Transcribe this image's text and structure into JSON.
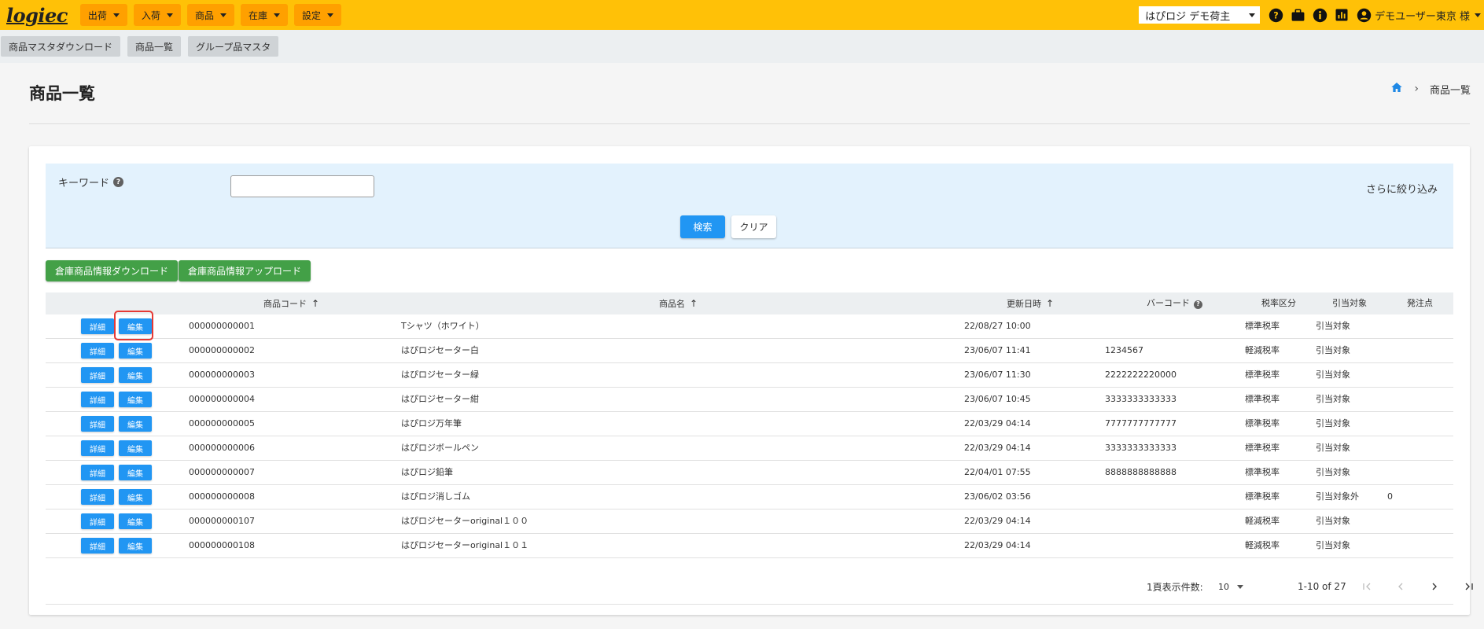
{
  "header": {
    "logo": "logiec",
    "menus": [
      {
        "label": "出荷"
      },
      {
        "label": "入荷"
      },
      {
        "label": "商品"
      },
      {
        "label": "在庫"
      },
      {
        "label": "設定"
      }
    ],
    "shipper_select": "はぴロジ デモ荷主",
    "user_name": "デモユーザー東京 様",
    "icons": [
      "help-circle-icon",
      "briefcase-icon",
      "info-icon",
      "bar-chart-icon",
      "account-circle-icon",
      "chevron-down-icon"
    ]
  },
  "subnav": {
    "items": [
      {
        "label": "商品マスタダウンロード"
      },
      {
        "label": "商品一覧"
      },
      {
        "label": "グループ品マスタ"
      }
    ]
  },
  "page": {
    "title": "商品一覧",
    "breadcrumb_current": "商品一覧"
  },
  "search": {
    "keyword_label": "キーワード",
    "help_mark": "?",
    "keyword_value": "",
    "narrow_link": "さらに絞り込み",
    "search_button": "検索",
    "clear_button": "クリア"
  },
  "actions": {
    "download_button": "倉庫商品情報ダウンロード",
    "upload_button": "倉庫商品情報アップロード"
  },
  "table": {
    "headers": {
      "code": "商品コード",
      "name": "商品名",
      "updated": "更新日時",
      "barcode": "バーコード",
      "tax": "税率区分",
      "allocation": "引当対象",
      "reorder": "発注点"
    },
    "sort_arrow": "↑",
    "detail_label": "詳細",
    "edit_label": "編集",
    "rows": [
      {
        "code": "000000000001",
        "name": "Tシャツ（ホワイト）",
        "updated": "22/08/27 10:00",
        "barcode": "",
        "tax": "標準税率",
        "allocation": "引当対象",
        "reorder": ""
      },
      {
        "code": "000000000002",
        "name": "はぴロジセーター白",
        "updated": "23/06/07 11:41",
        "barcode": "1234567",
        "tax": "軽減税率",
        "allocation": "引当対象",
        "reorder": ""
      },
      {
        "code": "000000000003",
        "name": "はぴロジセーター緑",
        "updated": "23/06/07 11:30",
        "barcode": "2222222220000",
        "tax": "標準税率",
        "allocation": "引当対象",
        "reorder": ""
      },
      {
        "code": "000000000004",
        "name": "はぴロジセーター紺",
        "updated": "23/06/07 10:45",
        "barcode": "3333333333333",
        "tax": "標準税率",
        "allocation": "引当対象",
        "reorder": ""
      },
      {
        "code": "000000000005",
        "name": "はぴロジ万年筆",
        "updated": "22/03/29 04:14",
        "barcode": "7777777777777",
        "tax": "標準税率",
        "allocation": "引当対象",
        "reorder": ""
      },
      {
        "code": "000000000006",
        "name": "はぴロジボールペン",
        "updated": "22/03/29 04:14",
        "barcode": "3333333333333",
        "tax": "標準税率",
        "allocation": "引当対象",
        "reorder": ""
      },
      {
        "code": "000000000007",
        "name": "はぴロジ鉛筆",
        "updated": "22/04/01 07:55",
        "barcode": "8888888888888",
        "tax": "標準税率",
        "allocation": "引当対象",
        "reorder": ""
      },
      {
        "code": "000000000008",
        "name": "はぴロジ消しゴム",
        "updated": "23/06/02 03:56",
        "barcode": "",
        "tax": "標準税率",
        "allocation": "引当対象外",
        "reorder": "0"
      },
      {
        "code": "000000000107",
        "name": "はぴロジセーターoriginal１００",
        "updated": "22/03/29 04:14",
        "barcode": "",
        "tax": "軽減税率",
        "allocation": "引当対象",
        "reorder": ""
      },
      {
        "code": "000000000108",
        "name": "はぴロジセーターoriginal１０１",
        "updated": "22/03/29 04:14",
        "barcode": "",
        "tax": "軽減税率",
        "allocation": "引当対象",
        "reorder": ""
      }
    ]
  },
  "pagination": {
    "per_page_label": "1頁表示件数:",
    "per_page_value": "10",
    "range": "1-10 of 27"
  },
  "colors": {
    "header_bg": "#ffc107",
    "menu_button": "#ffa000",
    "primary": "#2196f3",
    "success": "#43a047",
    "search_panel": "#e3f2fd",
    "highlight": "#e53935"
  }
}
